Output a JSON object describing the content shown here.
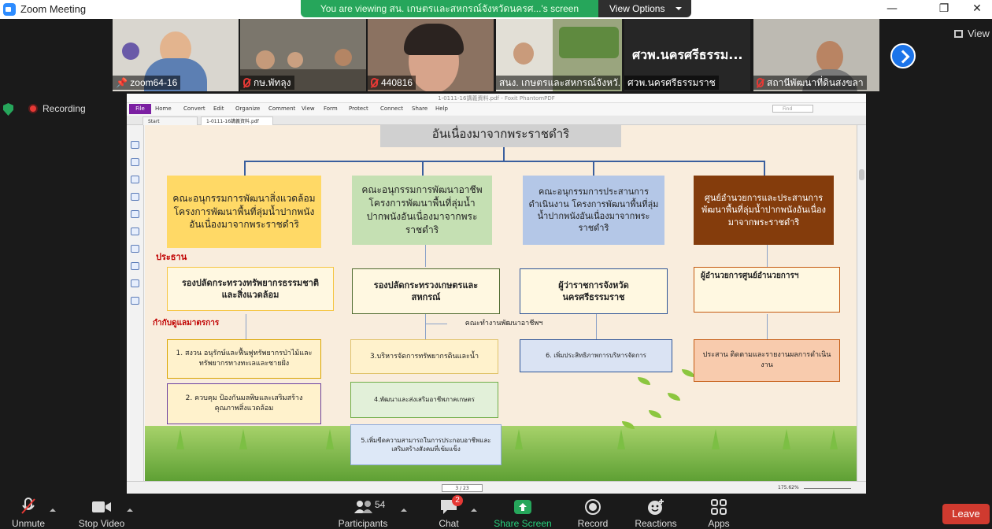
{
  "window": {
    "title": "Zoom Meeting"
  },
  "banner": {
    "message": "You are viewing สน. เกษตรและสหกรณ์จังหวัดนครศ...'s screen",
    "options": "View Options"
  },
  "participants_strip": [
    {
      "name": "zoom64-16",
      "muted": false
    },
    {
      "name": "กษ.พัทลุง",
      "muted": true
    },
    {
      "name": "440816",
      "muted": true
    },
    {
      "name": "สนง. เกษตรและสหกรณ์จังหวั...",
      "muted": false
    },
    {
      "name": "ศวพ.นครศรีธรรมราช",
      "muted": false,
      "display_text": "ศวพ.นครศรีธรรม..."
    },
    {
      "name": "สถานีพัฒนาที่ดินสงขลา",
      "muted": true
    }
  ],
  "view_button": "View",
  "recording": "Recording",
  "pdf": {
    "title": "1-0111-16講義資料.pdf - Foxit PhantomPDF",
    "menu": [
      "File",
      "Home",
      "Convert",
      "Edit",
      "Organize",
      "Comment",
      "View",
      "Form",
      "Protect",
      "Connect",
      "Share",
      "Help"
    ],
    "find": "Find",
    "tabs": [
      "Start",
      "1-0111-16講義資料.pdf"
    ],
    "page": "3 / 23",
    "zoom": "175.62%"
  },
  "slide": {
    "top_box": "อันเนื่องมาจากพระราชดำริ",
    "col1": {
      "header": "คณะอนุกรรมการพัฒนาสิ่งแวดล้อม โครงการพัฒนาพื้นที่ลุ่มน้ำปากพนังอันเนื่องมาจากพระราชดำริ",
      "chair_label": "ประธาน",
      "chair": "รองปลัดกระทรวงทรัพยากรธรรมชาติและสิ่งแวดล้อม",
      "oversee_label": "กำกับดูแลมาตรการ",
      "m1": "1. สงวน อนุรักษ์และฟื้นฟูทรัพยากรป่าไม้และทรัพยากรทางทะเลและชายฝั่ง",
      "m2": "2. ควบคุม ป้องกันมลพิษและเสริมสร้างคุณภาพสิ่งแวดล้อม"
    },
    "col2": {
      "header": "คณะอนุกรรมการพัฒนาอาชีพ โครงการพัฒนาพื้นที่ลุ่มน้ำปากพนังอันเนื่องมาจากพระราชดำริ",
      "chair": "รองปลัดกระทรวงเกษตรและสหกรณ์",
      "working_group": "คณะทำงานพัฒนาอาชีพฯ",
      "m3": "3.บริหารจัดการทรัพยากรดินและน้ำ",
      "m4": "4.พัฒนาและส่งเสริมอาชีพภาคเกษตร",
      "m5": "5.เพิ่มขีดความสามารถในการประกอบอาชีพและเสริมสร้างสังคมที่เข้มแข็ง"
    },
    "col3": {
      "header": "คณะอนุกรรมการประสานการดำเนินงาน โครงการพัฒนาพื้นที่ลุ่มน้ำปากพนังอันเนื่องมาจากพระราชดำริ",
      "chair": "ผู้ว่าราชการจังหวัดนครศรีธรรมราช",
      "m6": "6. เพิ่มประสิทธิภาพการบริหารจัดการ"
    },
    "col4": {
      "header": "ศูนย์อำนวยการและประสานการพัฒนาพื้นที่ลุ่มน้ำปากพนังอันเนื่องมาจากพระราชดำริ",
      "chair": "ผู้อำนวยการศูนย์อำนวยการฯ",
      "task": "ประสาน ติดตามและรายงานผลการดำเนินงาน"
    }
  },
  "toolbar": {
    "unmute": "Unmute",
    "stop_video": "Stop Video",
    "participants": "Participants",
    "participants_count": "54",
    "chat": "Chat",
    "chat_badge": "2",
    "share_screen": "Share Screen",
    "record": "Record",
    "reactions": "Reactions",
    "apps": "Apps",
    "leave": "Leave"
  },
  "colors": {
    "zoom_blue": "#1c74e9",
    "banner_green": "#26a65b",
    "leave_red": "#d03a2f"
  }
}
